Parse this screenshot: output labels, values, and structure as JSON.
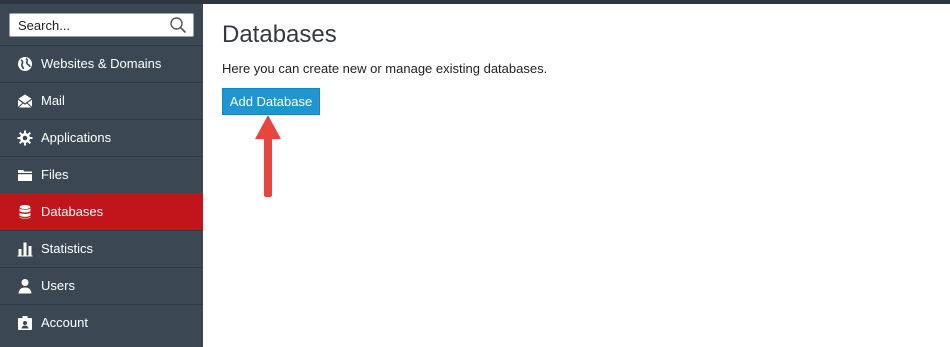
{
  "search": {
    "placeholder": "Search..."
  },
  "sidebar": {
    "items": [
      {
        "label": "Websites & Domains",
        "icon": "globe-icon"
      },
      {
        "label": "Mail",
        "icon": "envelope-icon"
      },
      {
        "label": "Applications",
        "icon": "gear-icon"
      },
      {
        "label": "Files",
        "icon": "folder-icon"
      },
      {
        "label": "Databases",
        "icon": "database-icon",
        "active": true
      },
      {
        "label": "Statistics",
        "icon": "bar-chart-icon"
      },
      {
        "label": "Users",
        "icon": "user-icon"
      },
      {
        "label": "Account",
        "icon": "id-card-icon"
      }
    ]
  },
  "main": {
    "title": "Databases",
    "description": "Here you can create new or manage existing databases.",
    "add_button_label": "Add Database"
  },
  "colors": {
    "sidebar": "#3b4853",
    "active_item": "#c0161b",
    "button": "#1f96d1",
    "annotation_arrow": "#e8453c"
  }
}
